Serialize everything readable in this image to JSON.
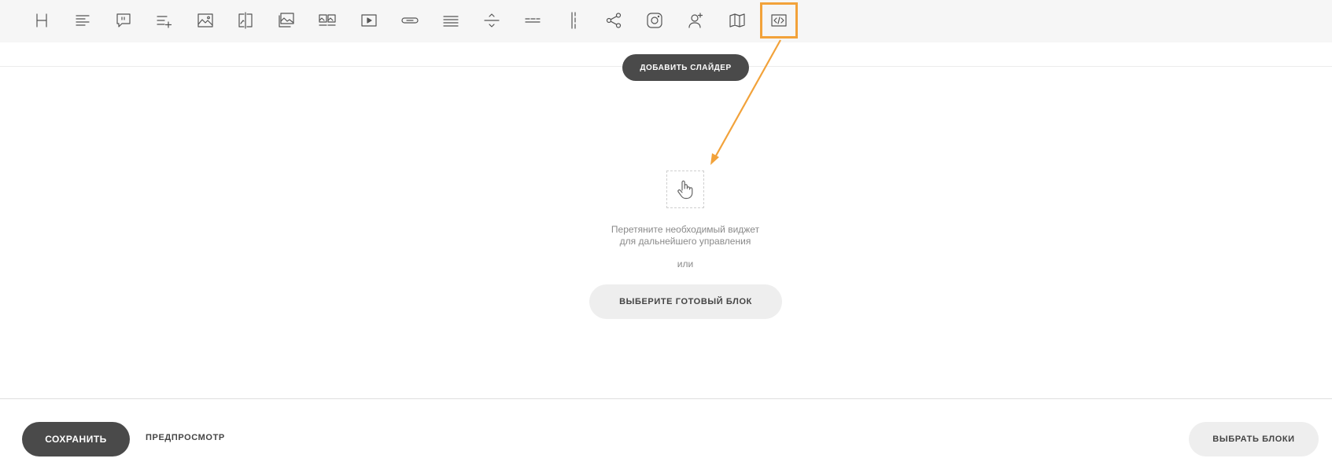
{
  "toolbar": {
    "tools": [
      {
        "name": "heading-tool",
        "icon": "heading-icon"
      },
      {
        "name": "text-tool",
        "icon": "text-align-icon"
      },
      {
        "name": "quote-tool",
        "icon": "quote-icon"
      },
      {
        "name": "list-tool",
        "icon": "list-add-icon"
      },
      {
        "name": "image-tool",
        "icon": "image-icon"
      },
      {
        "name": "before-after-tool",
        "icon": "before-after-icon"
      },
      {
        "name": "image-caption-tool",
        "icon": "image-caption-icon"
      },
      {
        "name": "gallery-tool",
        "icon": "gallery-icon"
      },
      {
        "name": "video-tool",
        "icon": "video-icon"
      },
      {
        "name": "button-tool",
        "icon": "button-icon"
      },
      {
        "name": "block-tool",
        "icon": "lines-icon"
      },
      {
        "name": "spacer-tool",
        "icon": "spacer-icon"
      },
      {
        "name": "separator-tool",
        "icon": "separator-icon"
      },
      {
        "name": "columns-tool",
        "icon": "column-divider-icon"
      },
      {
        "name": "share-tool",
        "icon": "share-icon"
      },
      {
        "name": "instagram-tool",
        "icon": "instagram-icon"
      },
      {
        "name": "author-tool",
        "icon": "add-user-icon"
      },
      {
        "name": "map-tool",
        "icon": "map-icon"
      },
      {
        "name": "html-code-tool",
        "icon": "code-icon",
        "active": true
      }
    ]
  },
  "colors": {
    "accent": "#f2a23a",
    "dark_button": "#4a4a4a",
    "light_button": "#eeeeee",
    "toolbar_bg": "#f6f6f6"
  },
  "editor": {
    "add_slider_label": "ДОБАВИТЬ СЛАЙДЕР",
    "drop_icon": "hand-pointer-icon",
    "hint_line1": "Перетяните необходимый виджет",
    "hint_line2": "для дальнейшего управления",
    "or_text": "или",
    "choose_block_label": "ВЫБЕРИТЕ ГОТОВЫЙ БЛОК"
  },
  "footer": {
    "save_label": "СОХРАНИТЬ",
    "preview_label": "ПРЕДПРОСМОТР",
    "pick_blocks_label": "ВЫБРАТЬ БЛОКИ"
  }
}
